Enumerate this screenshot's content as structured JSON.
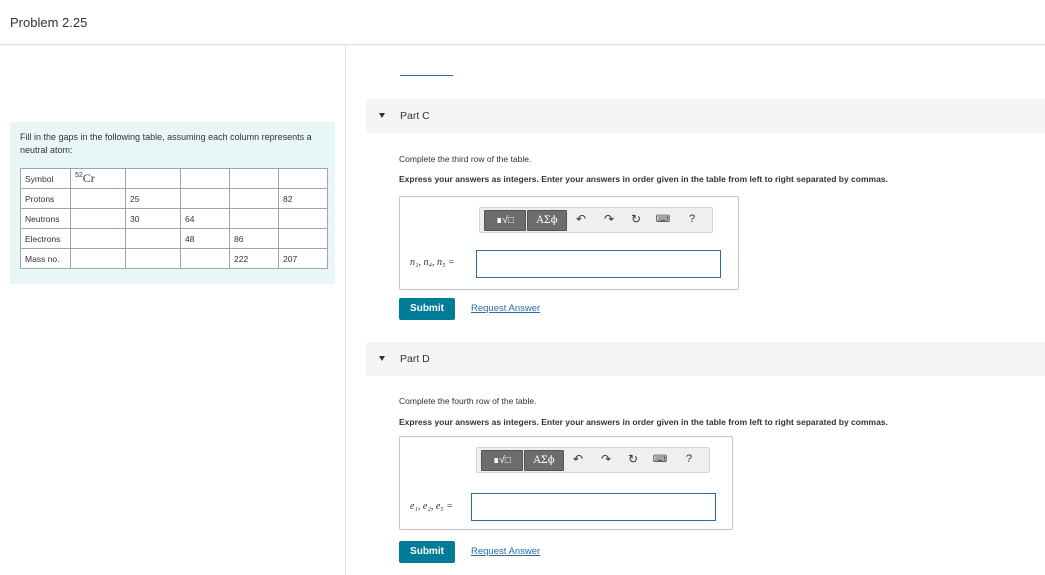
{
  "page": {
    "title": "Problem 2.25"
  },
  "problem": {
    "intro": "Fill in the gaps in the following table, assuming each column represents a neutral atom:",
    "table": {
      "symbol_label": "Symbol",
      "symbol_mass": "52",
      "symbol_element": "Cr",
      "rows": [
        {
          "label": "Protons",
          "cells": [
            "",
            "25",
            "",
            "",
            "82"
          ]
        },
        {
          "label": "Neutrons",
          "cells": [
            "",
            "30",
            "64",
            "",
            ""
          ]
        },
        {
          "label": "Electrons",
          "cells": [
            "",
            "",
            "48",
            "86",
            ""
          ]
        },
        {
          "label": "Mass no.",
          "cells": [
            "",
            "",
            "",
            "222",
            "207"
          ]
        }
      ]
    }
  },
  "toolbar": {
    "template_label": "∎√□",
    "symbols_label": "ΑΣϕ",
    "undo_icon": "undo-icon",
    "redo_icon": "redo-icon",
    "reset_icon": "reset-icon",
    "keyboard_icon": "keyboard-icon",
    "help_label": "?"
  },
  "parts": [
    {
      "title": "Part C",
      "instruction": "Complete the third row of the table.",
      "express": "Express your answers as integers. Enter your answers in order given in the table from left to right separated by commas.",
      "var_label": "n₁, n₄, n₅ =",
      "input_value": "",
      "submit_label": "Submit",
      "request_label": "Request Answer"
    },
    {
      "title": "Part D",
      "instruction": "Complete the fourth row of the table.",
      "express": "Express your answers as integers. Enter your answers in order given in the table from left to right separated by commas.",
      "var_label": "e₁, e₂, e₅ =",
      "input_value": "",
      "submit_label": "Submit",
      "request_label": "Request Answer"
    }
  ]
}
